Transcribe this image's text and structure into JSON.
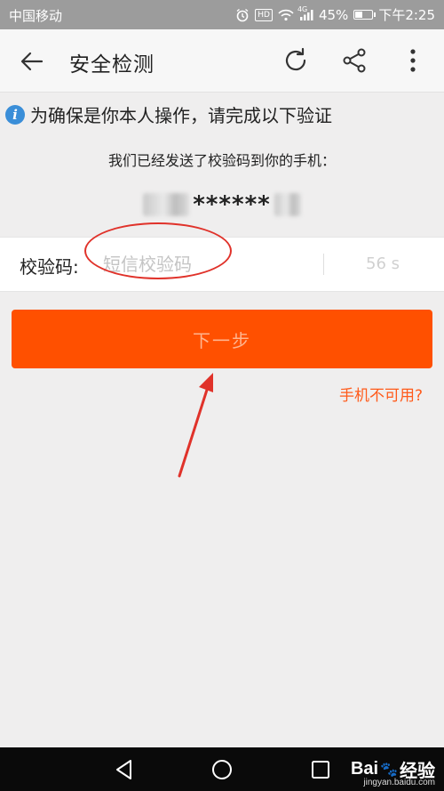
{
  "status_bar": {
    "carrier": "中国移动",
    "hd": "HD",
    "net": "4G",
    "battery_percent": "45%",
    "battery_level": 0.45,
    "time": "下午2:25"
  },
  "header": {
    "title": "安全检测"
  },
  "notice": {
    "text": "为确保是你本人操作，请完成以下验证"
  },
  "sent_message": "我们已经发送了校验码到你的手机：",
  "phone_masked": "******",
  "code_row": {
    "label": "校验码:",
    "placeholder": "短信校验码",
    "value": "",
    "countdown": "56 s"
  },
  "next_button": {
    "label": "下一步"
  },
  "phone_unavailable_link": "手机不可用?",
  "watermark": {
    "brand": "Bai",
    "brand_cn": "经验",
    "url": "jingyan.baidu.com"
  },
  "colors": {
    "accent": "#ff5000",
    "link": "#ff5a1a",
    "annotation": "#e0322a"
  }
}
